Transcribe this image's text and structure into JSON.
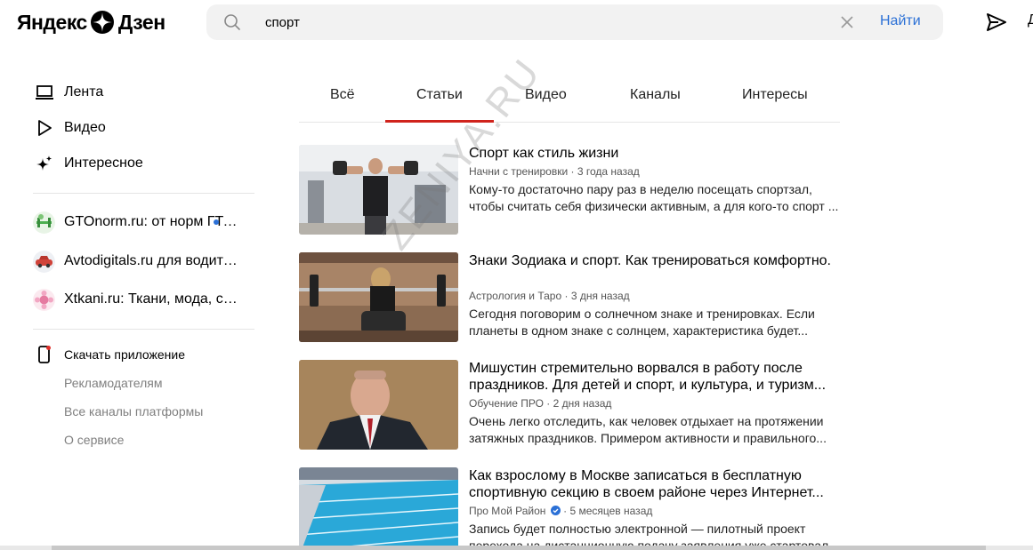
{
  "header": {
    "logo_left": "Яндекс",
    "logo_right": "Дзен",
    "search_value": "спорт",
    "search_button": "Найти",
    "edge_text": "Д"
  },
  "sidebar": {
    "nav": [
      {
        "label": "Лента",
        "icon": "feed-icon"
      },
      {
        "label": "Видео",
        "icon": "play-icon"
      },
      {
        "label": "Интересное",
        "icon": "sparkle-icon"
      }
    ],
    "channels": [
      {
        "label": "GTOnorm.ru: от норм ГТО...",
        "has_update": true
      },
      {
        "label": "Avtodigitals.ru для водителей",
        "has_update": false
      },
      {
        "label": "Xtkani.ru: Ткани, мода, стиль",
        "has_update": false
      }
    ],
    "app_link": "Скачать приложение",
    "links": [
      "Рекламодателям",
      "Все каналы платформы",
      "О сервисе"
    ]
  },
  "tabs": [
    "Всё",
    "Статьи",
    "Видео",
    "Каналы",
    "Интересы"
  ],
  "active_tab": "Статьи",
  "articles": [
    {
      "title": "Спорт как стиль жизни",
      "source": "Начни с тренировки",
      "time": "3 года назад",
      "verified": false,
      "desc": "Кому-то достаточно пару раз в неделю посещать спортзал, чтобы считать себя физически активным, а для кого-то спорт ..."
    },
    {
      "title": "Знаки Зодиака и спорт. Как тренироваться комфортно.",
      "source": "Астрология и Таро",
      "time": "3 дня назад",
      "verified": false,
      "desc": "Сегодня поговорим о солнечном знаке и тренировках. Если планеты в одном знаке с солнцем, характеристика будет..."
    },
    {
      "title": "Мишустин стремительно ворвался в работу после праздников. Для детей и спорт, и культура, и туризм...",
      "source": "Обучение ПРО",
      "time": "2 дня назад",
      "verified": false,
      "desc": "Очень легко отследить, как человек отдыхает на протяжении затяжных праздников. Примером активности и правильного..."
    },
    {
      "title": "Как взрослому в Москве записаться в бесплатную спортивную секцию в своем районе через Интернет...",
      "source": "Про Мой Район",
      "time": "5 месяцев назад",
      "verified": true,
      "desc": "Запись будет полностью электронной — пилотный проект перехода на дистанционную подачу заявления уже стартовал..."
    }
  ],
  "meta_separator": " · ",
  "watermark": "ZENIYA.RU",
  "colors": {
    "accent_red": "#d0231c",
    "link_blue": "#2b70d6",
    "search_bg": "#f2f2f2",
    "muted_text": "#7f7f7f"
  }
}
